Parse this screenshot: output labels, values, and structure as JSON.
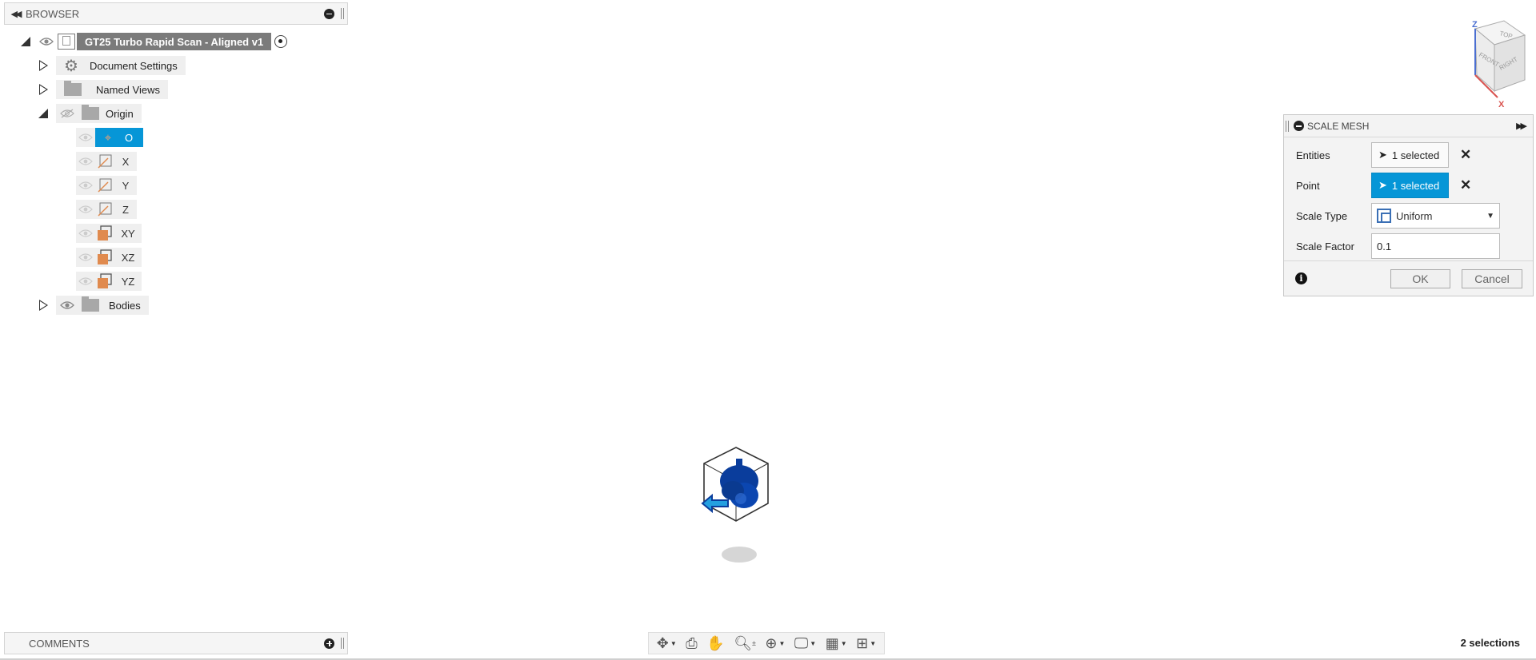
{
  "browser": {
    "title": "BROWSER",
    "root": "GT25 Turbo Rapid Scan - Aligned v1",
    "items": {
      "document_settings": "Document Settings",
      "named_views": "Named Views",
      "origin": "Origin",
      "bodies": "Bodies"
    },
    "origin_children": [
      "O",
      "X",
      "Y",
      "Z",
      "XY",
      "XZ",
      "YZ"
    ]
  },
  "dialog": {
    "title": "SCALE MESH",
    "entities_label": "Entities",
    "entities_value": "1 selected",
    "point_label": "Point",
    "point_value": "1 selected",
    "scale_type_label": "Scale Type",
    "scale_type_value": "Uniform",
    "scale_factor_label": "Scale Factor",
    "scale_factor_value": "0.1",
    "ok": "OK",
    "cancel": "Cancel",
    "clear_glyph": "✕",
    "info_glyph": "i"
  },
  "viewcube": {
    "faces": [
      "TOP",
      "FRONT",
      "RIGHT"
    ],
    "axes": [
      "Z",
      "X"
    ]
  },
  "comments": {
    "title": "COMMENTS"
  },
  "status": {
    "selections": "2 selections"
  },
  "colors": {
    "selection_blue": "#0696d7",
    "model_blue": "#0a3d9c",
    "origin_plane_orange": "#e08a4e"
  },
  "toolbar": {
    "icons": [
      "orbit-icon",
      "look-at-icon",
      "pan-icon",
      "zoom-icon",
      "fit-icon",
      "display-settings-icon",
      "grid-icon",
      "viewports-icon"
    ]
  }
}
